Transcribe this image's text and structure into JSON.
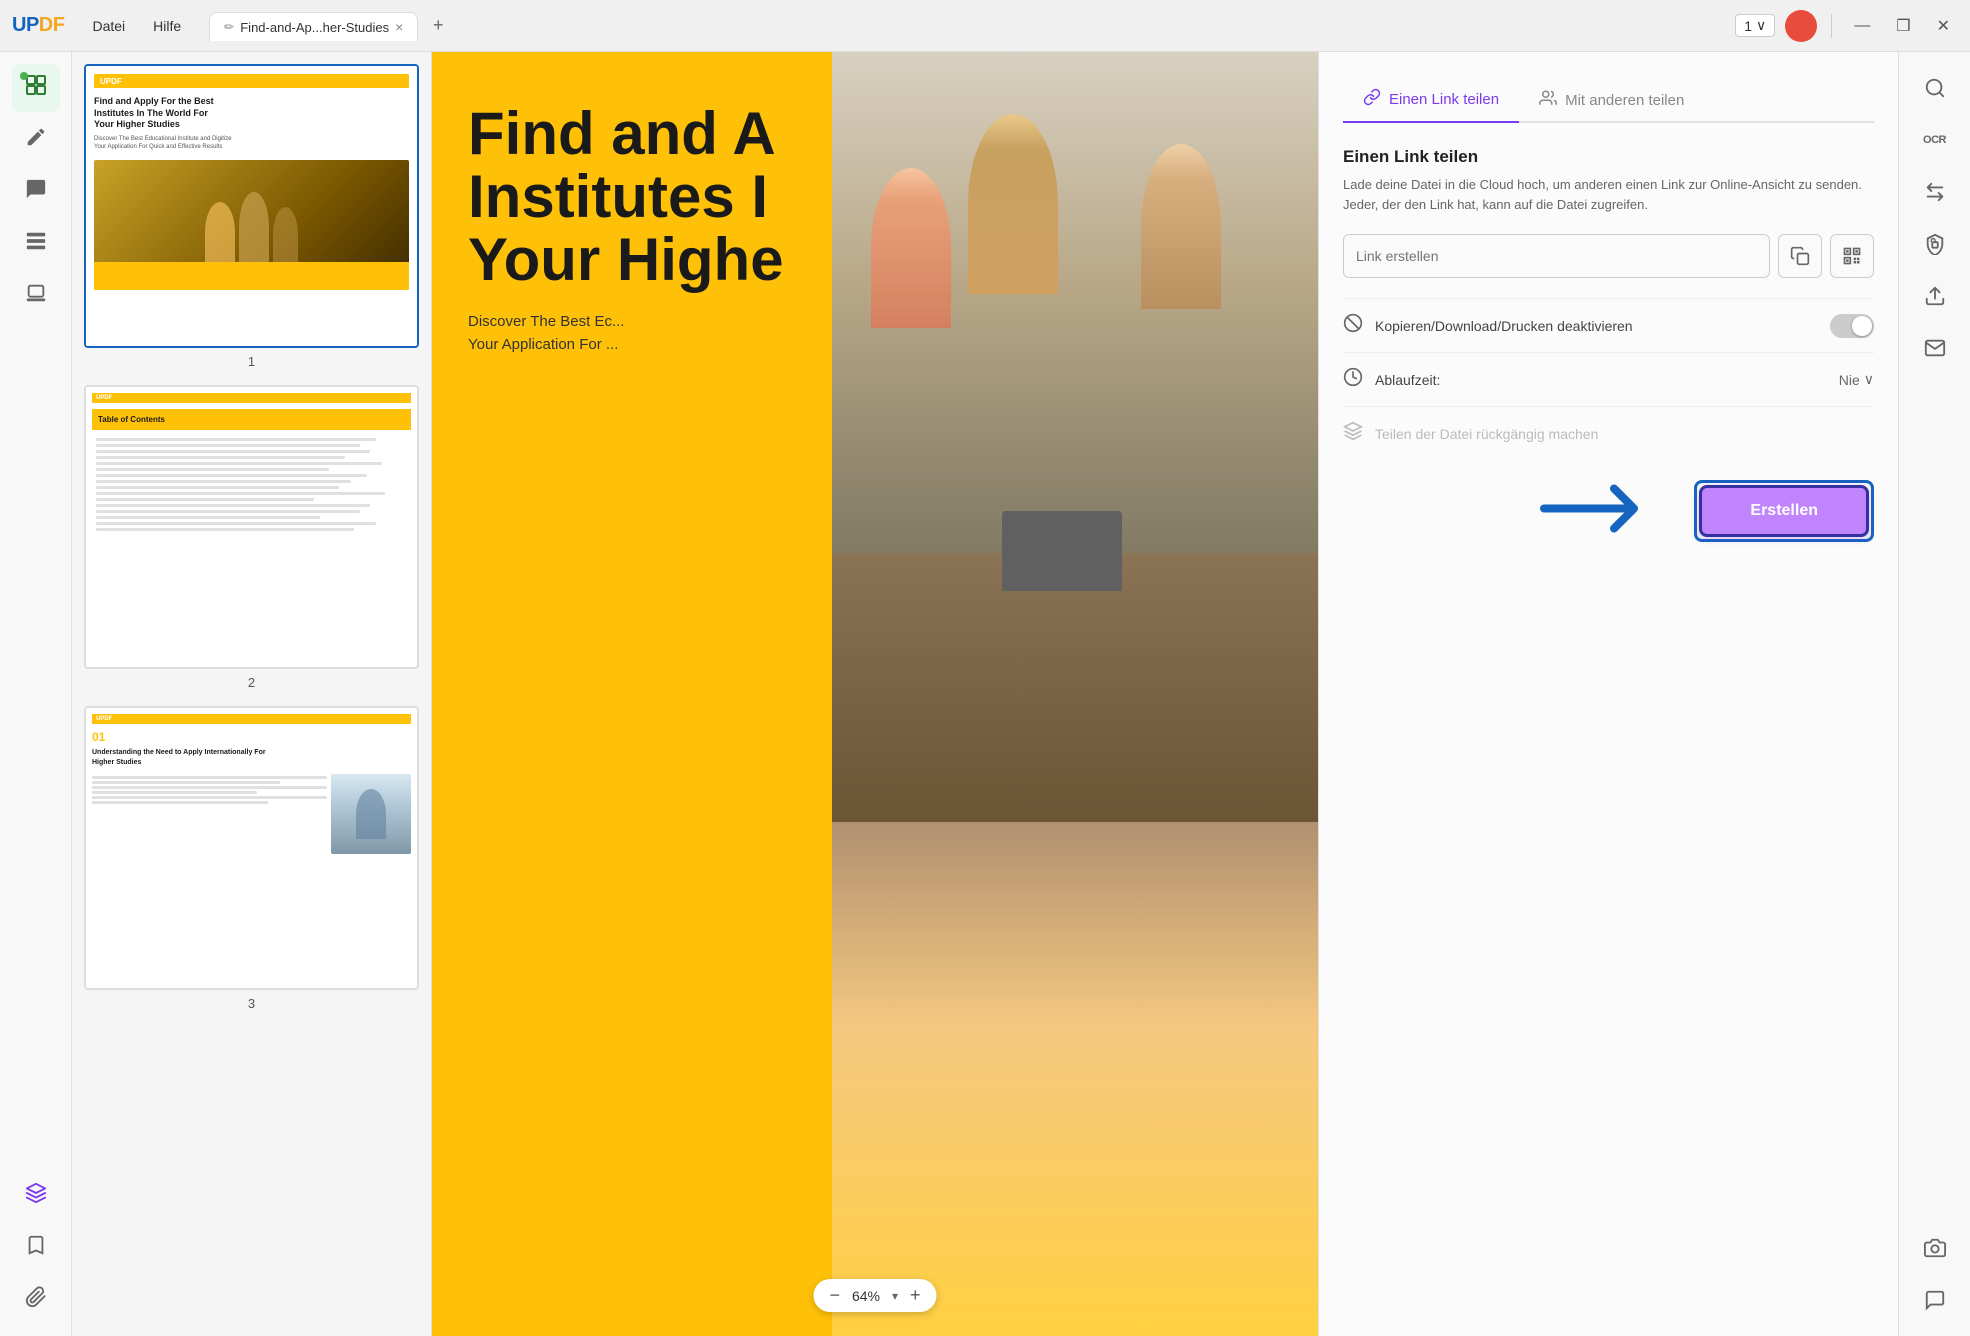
{
  "titlebar": {
    "logo": "UPDF",
    "menu": {
      "file": "Datei",
      "help": "Hilfe"
    },
    "tab": {
      "icon": "✏",
      "label": "Find-and-Ap...her-Studies",
      "close": "×"
    },
    "tab_add": "+",
    "page_indicator": {
      "current": "1",
      "dropdown": "∨"
    },
    "win_minimize": "—",
    "win_restore": "❐",
    "win_close": "✕"
  },
  "left_sidebar": {
    "icons": [
      {
        "name": "thumbnails-icon",
        "symbol": "⊞",
        "active": true
      },
      {
        "name": "pen-icon",
        "symbol": "✏"
      },
      {
        "name": "comment-icon",
        "symbol": "💬"
      },
      {
        "name": "organize-icon",
        "symbol": "⊟"
      },
      {
        "name": "stamp-icon",
        "symbol": "⊡"
      },
      {
        "name": "layers-icon",
        "symbol": "⬡",
        "purple": true
      },
      {
        "name": "bookmark-icon",
        "symbol": "🔖"
      },
      {
        "name": "paperclip-icon",
        "symbol": "📎"
      }
    ]
  },
  "thumbnails": [
    {
      "id": 1,
      "label": "1"
    },
    {
      "id": 2,
      "label": "2"
    },
    {
      "id": 3,
      "label": "3"
    }
  ],
  "zoom": {
    "minus": "−",
    "value": "64%",
    "dropdown": "▾",
    "plus": "+"
  },
  "pdf_page1": {
    "title_line1": "Find and A",
    "title_line2": "Institutes I",
    "title_line3": "Your Highe",
    "subtitle": "Discover The Best Ec...\nYour Application For ..."
  },
  "share_panel": {
    "tabs": [
      {
        "id": "link",
        "icon": "🔗",
        "label": "Einen Link teilen",
        "active": true
      },
      {
        "id": "share",
        "icon": "👥",
        "label": "Mit anderen teilen"
      }
    ],
    "section_title": "Einen Link teilen",
    "section_desc": "Lade deine Datei in die Cloud hoch, um anderen einen Link zur Online-Ansicht zu senden. Jeder, der den Link hat, kann auf die Datei zugreifen.",
    "link_placeholder": "Link erstellen",
    "copy_icon": "⧉",
    "qr_icon": "⊞",
    "options": [
      {
        "id": "copy-download-print",
        "icon": "⊗",
        "label": "Kopieren/Download/Drucken deaktivieren",
        "toggle": true,
        "toggle_on": false
      }
    ],
    "expire": {
      "icon": "🕐",
      "label": "Ablaufzeit:",
      "value": "Nie",
      "dropdown": "∨"
    },
    "revoke": {
      "icon": "⚙",
      "label": "Teilen der Datei rückgängig machen",
      "disabled": true
    },
    "create_button": "Erstellen"
  },
  "right_sidebar": {
    "icons": [
      {
        "name": "search-icon",
        "symbol": "🔍"
      },
      {
        "name": "ocr-icon",
        "symbol": "OCR"
      },
      {
        "name": "convert-icon",
        "symbol": "⇄"
      },
      {
        "name": "protect-icon",
        "symbol": "🔒"
      },
      {
        "name": "upload-icon",
        "symbol": "⬆"
      },
      {
        "name": "email-icon",
        "symbol": "✉"
      },
      {
        "name": "camera-icon",
        "symbol": "📷"
      },
      {
        "name": "chat-icon",
        "symbol": "💬"
      }
    ]
  },
  "page3_thumbnail": {
    "number": "01",
    "title": "Understanding\nthe Need to Apply\nInternationally For\nHigher Studies"
  }
}
